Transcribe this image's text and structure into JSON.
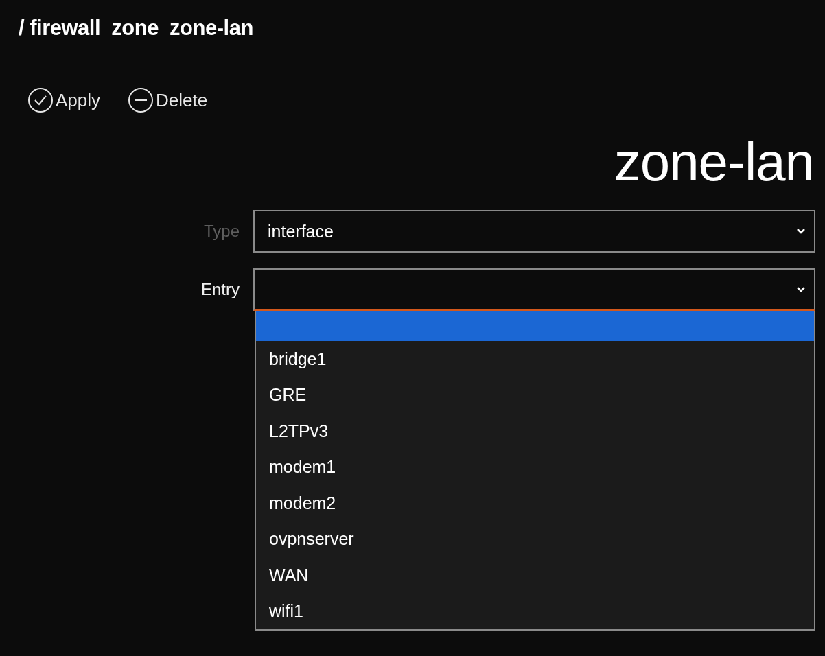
{
  "breadcrumb": "/ firewall  zone  zone-lan",
  "toolbar": [
    {
      "kind": "apply",
      "label": "Apply"
    },
    {
      "kind": "delete",
      "label": "Delete"
    }
  ],
  "heading": "zone-lan",
  "fields": [
    {
      "label": "Type",
      "value": "interface",
      "disabled": true,
      "open": false
    },
    {
      "label": "Entry",
      "disabled": false,
      "open": true,
      "options": [
        {
          "selected": true
        },
        {
          "label": "bridge1",
          "selected": false
        },
        {
          "label": "GRE",
          "selected": false
        },
        {
          "label": "L2TPv3",
          "selected": false
        },
        {
          "label": "modem1",
          "selected": false
        },
        {
          "label": "modem2",
          "selected": false
        },
        {
          "label": "ovpnserver",
          "selected": false
        },
        {
          "label": "WAN",
          "selected": false
        },
        {
          "label": "wifi1",
          "selected": false
        }
      ]
    }
  ]
}
